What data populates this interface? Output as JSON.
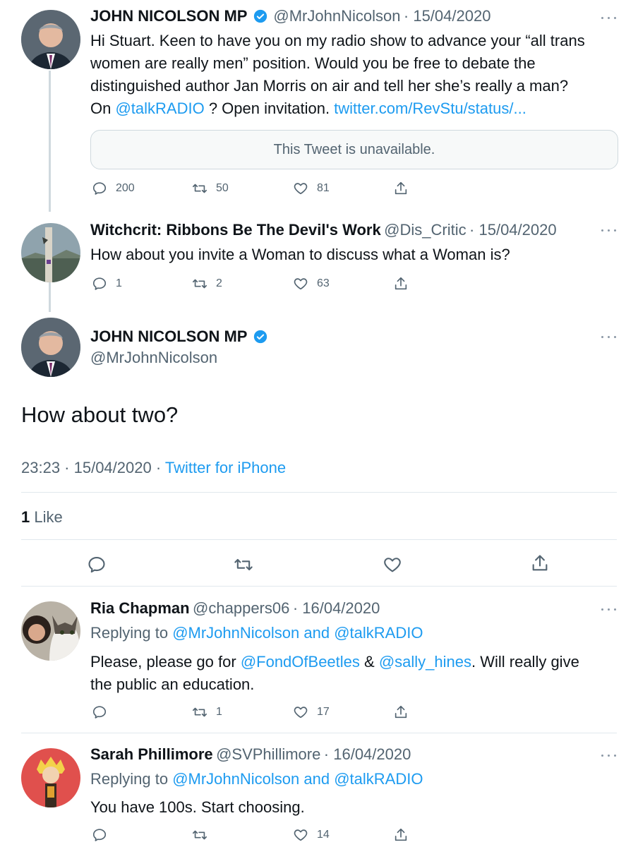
{
  "colors": {
    "accent": "#1d9bf0",
    "secondary": "#536471",
    "border": "#e1e8ed",
    "verified": "#1d9bf0"
  },
  "tweet1": {
    "name": "JOHN NICOLSON MP",
    "handle": "@MrJohnNicolson",
    "date": "· 15/04/2020",
    "line1": "Hi Stuart. Keen to have you on my radio show to advance your “all trans",
    "line2": "women are really men” position. Would you be free to debate the",
    "line3": "distinguished author Jan Morris on air and tell her she’s really a man?",
    "line4_a": "On ",
    "line4_link1": "@talkRADIO",
    "line4_b": " ? Open invitation. ",
    "line4_link2": "twitter.com/RevStu/status/...",
    "quote_unavailable": "This Tweet is unavailable.",
    "replies": "200",
    "retweets": "50",
    "likes": "81"
  },
  "tweet2": {
    "name": "Witchcrit: Ribbons Be The Devil's Work",
    "handle": "@Dis_Critic",
    "date": "· 15/04/2020",
    "text": "How about you invite a Woman to discuss what a Woman is?",
    "replies": "1",
    "retweets": "2",
    "likes": "63"
  },
  "main": {
    "name": "JOHN NICOLSON MP",
    "handle": "@MrJohnNicolson",
    "text": "How about two?",
    "time": "23:23 · 15/04/2020 · ",
    "source": "Twitter for iPhone",
    "like_count": "1",
    "like_label": " Like"
  },
  "reply1": {
    "name": "Ria Chapman",
    "handle": "@chappers06",
    "date": "· 16/04/2020",
    "replying_prefix": "Replying to ",
    "replying_user1": "@MrJohnNicolson",
    "replying_and": " and ",
    "replying_user2": "@talkRADIO",
    "text_a": "Please, please go for ",
    "link1": "@FondOfBeetles",
    "text_b": " & ",
    "link2": "@sally_hines",
    "text_c": ". Will really give",
    "line2": "the public an education.",
    "replies": "",
    "retweets": "1",
    "likes": "17"
  },
  "reply2": {
    "name": "Sarah Phillimore",
    "handle": "@SVPhillimore",
    "date": "· 16/04/2020",
    "replying_prefix": "Replying to ",
    "replying_user1": "@MrJohnNicolson",
    "replying_and": " and ",
    "replying_user2": "@talkRADIO",
    "text": "You have 100s. Start choosing.",
    "replies": "",
    "retweets": "",
    "likes": "14"
  }
}
